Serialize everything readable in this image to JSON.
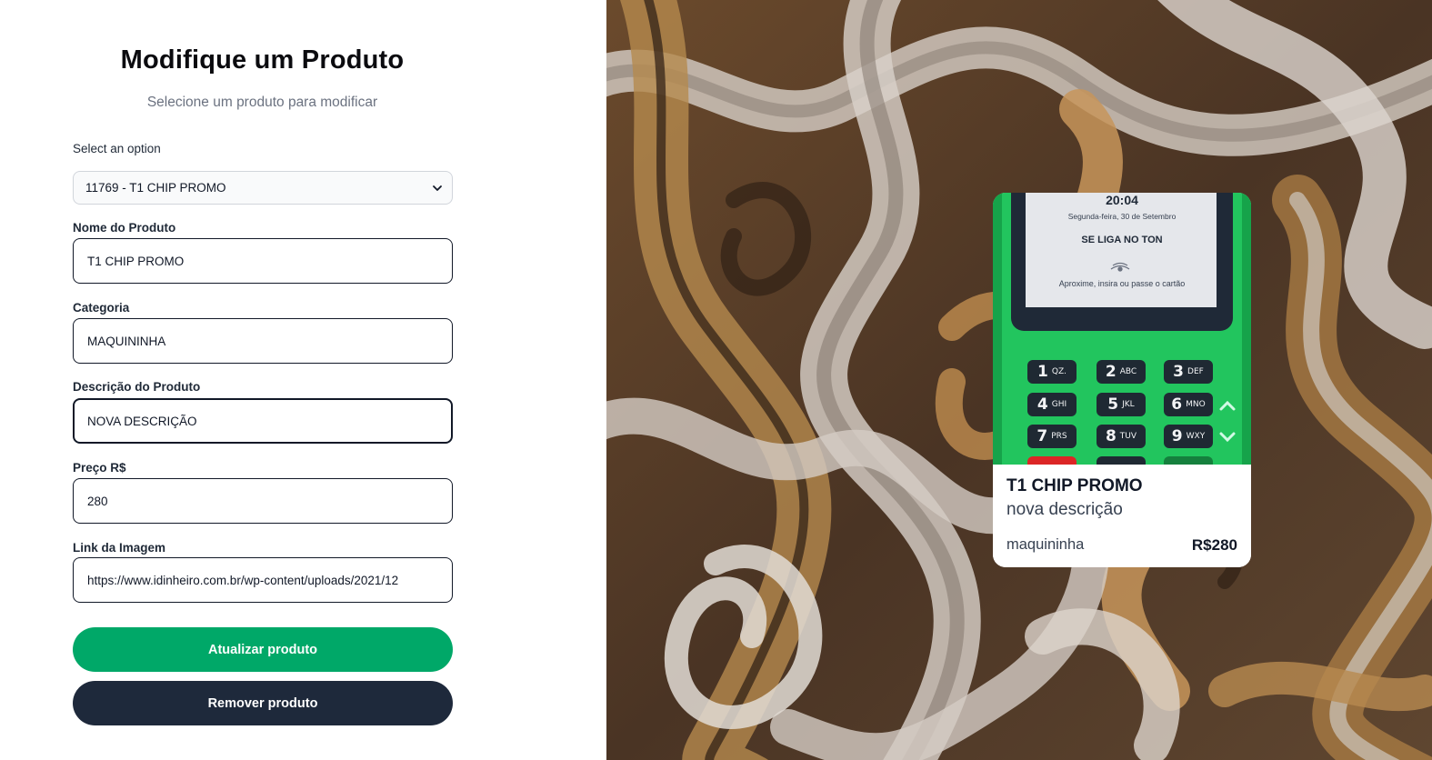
{
  "header": {
    "title": "Modifique um Produto",
    "subtitle": "Selecione um produto para modificar"
  },
  "form": {
    "select_label": "Select an option",
    "select_value": "11769 - T1 CHIP PROMO",
    "name_label": "Nome do Produto",
    "name_value": "T1 CHIP PROMO",
    "category_label": "Categoria",
    "category_value": "MAQUININHA",
    "description_label": "Descrição do Produto",
    "description_value": "NOVA DESCRIÇÃO",
    "price_label": "Preço R$",
    "price_value": "280",
    "image_label": "Link da Imagem",
    "image_value": "https://www.idinheiro.com.br/wp-content/uploads/2021/12"
  },
  "buttons": {
    "update_label": "Atualizar produto",
    "remove_label": "Remover produto"
  },
  "card": {
    "name": "T1 CHIP PROMO",
    "description": "nova descrição",
    "category": "maquininha",
    "price": "R$280",
    "image": {
      "time": "20:04",
      "date": "Segunda-feira, 30 de Setembro",
      "slogan": "SE LIGA NO TON",
      "hint": "Aproxime, insira ou passe o cartão",
      "keys": [
        "1",
        "QZ.",
        "2",
        "ABC",
        "3",
        "DEF",
        "4",
        "GHI",
        "5",
        "JKL",
        "6",
        "MNO",
        "7",
        "PRS",
        "8",
        "TUV",
        "9",
        "WXY"
      ]
    }
  },
  "colors": {
    "primary_button": "#00a868",
    "secondary_button": "#1e293b",
    "terminal_green": "#22c55e"
  },
  "icons": {
    "select_arrow": "chevron-down-icon",
    "contactless": "contactless-icon",
    "up": "chevron-up-icon",
    "down": "chevron-down-icon"
  }
}
